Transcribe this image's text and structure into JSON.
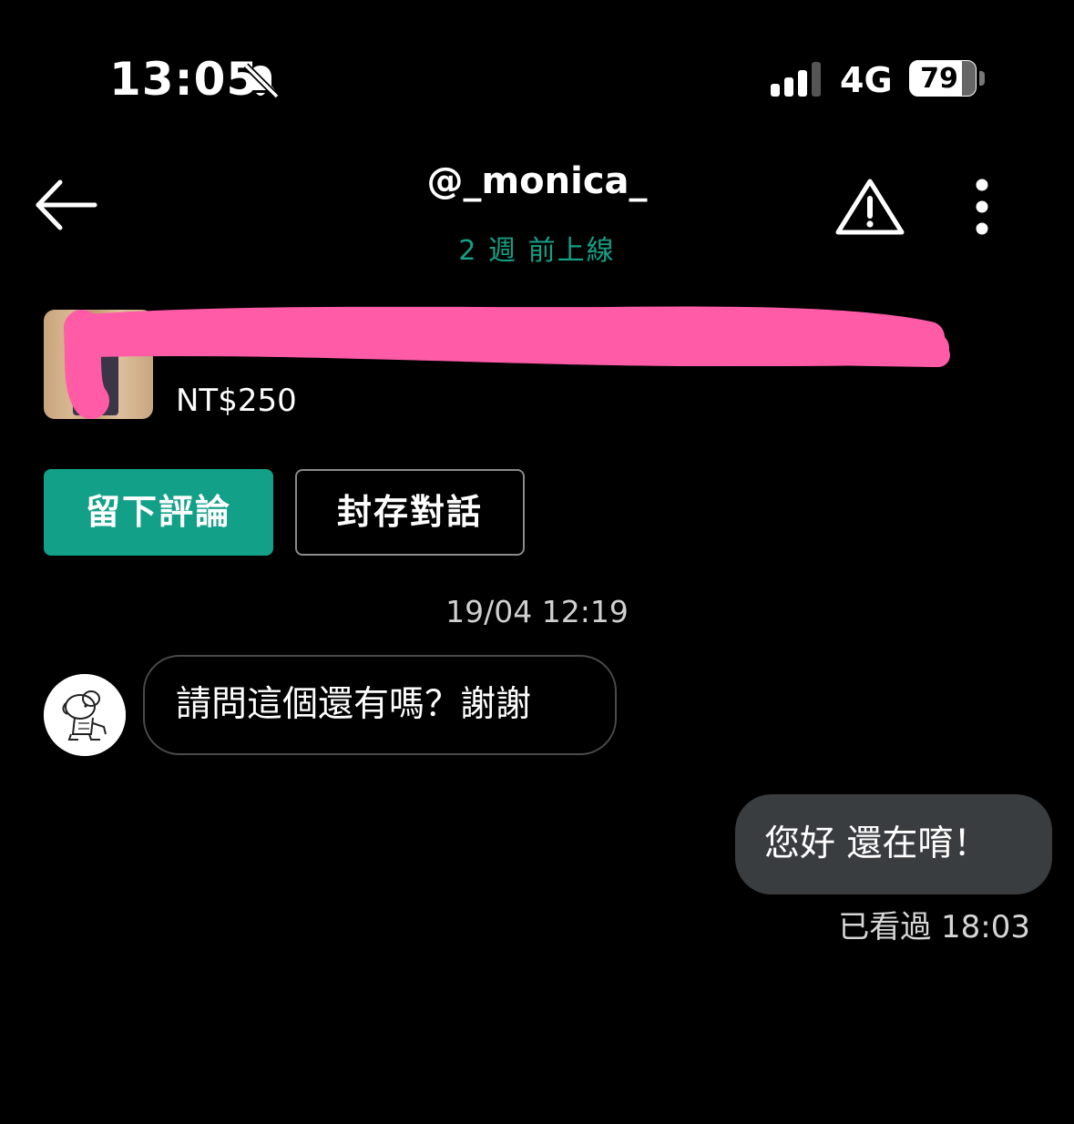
{
  "status_bar": {
    "time": "13:05",
    "network": "4G",
    "battery": "79",
    "battery_fraction": 0.79
  },
  "header": {
    "back_icon": "arrow-left-icon",
    "username": "@_monica_",
    "last_seen": "2 週 前上線",
    "report_icon": "warning-triangle-icon",
    "more_icon": "vertical-dots-icon"
  },
  "listing": {
    "title": "\\... ... ...",
    "price": "NT$250"
  },
  "actions": {
    "review_label": "留下評論",
    "archive_label": "封存對話"
  },
  "conversation": {
    "timestamp": "19/04 12:19",
    "messages": [
      {
        "direction": "incoming",
        "text": "請問這個還有嗎？謝謝"
      },
      {
        "direction": "outgoing",
        "text": "您好 還在唷！",
        "status": "已看過 18:03"
      }
    ]
  },
  "colors": {
    "accent": "#13a088",
    "background": "#000000",
    "outgoing_bubble": "#3a3d40",
    "redaction": "#ff5ba7"
  }
}
